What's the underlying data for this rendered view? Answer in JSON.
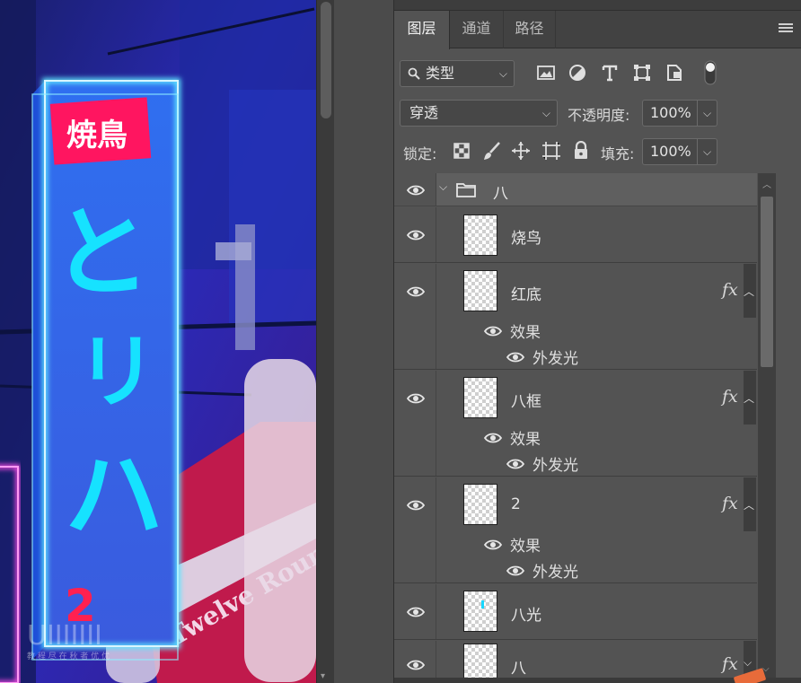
{
  "canvas": {
    "sign_title": "焼鳥",
    "sign_chars": [
      "と",
      "リ",
      "ハ"
    ],
    "sign_number": "2",
    "watermark_letters": "UIIIIIII",
    "watermark_caption": "教 程 尽 在 秋 者 优 优",
    "lantern_text": "Twelve Rounds Inn"
  },
  "tabs": [
    {
      "label": "图层"
    },
    {
      "label": "通道"
    },
    {
      "label": "路径"
    }
  ],
  "filter": {
    "kind_label": "类型",
    "icons": [
      "image-filter-icon",
      "adjustment-filter-icon",
      "type-filter-icon",
      "shape-filter-icon",
      "smart-object-filter-icon",
      "filter-toggle-icon"
    ]
  },
  "blend": {
    "mode": "穿透",
    "opacity_label": "不透明度:",
    "opacity_value": "100%"
  },
  "lock": {
    "label": "锁定:",
    "fill_label": "填充:",
    "fill_value": "100%"
  },
  "layers": {
    "group": {
      "name": "八"
    },
    "items": [
      {
        "name": "烧鸟",
        "fx": ""
      },
      {
        "name": "红底",
        "fx": "fx",
        "effects_label": "效果",
        "effect": "外发光"
      },
      {
        "name": "八框",
        "fx": "fx",
        "effects_label": "效果",
        "effect": "外发光"
      },
      {
        "name": "2",
        "fx": "fx",
        "effects_label": "效果",
        "effect": "外发光"
      },
      {
        "name": "八光",
        "fx": ""
      },
      {
        "name": "八",
        "fx": "fx"
      }
    ]
  },
  "colors": {
    "panel_bg": "#535353",
    "neon_blue": "#19d8ff",
    "neon_pink": "#ff1f6a",
    "accent_orange": "#e86b3a"
  }
}
